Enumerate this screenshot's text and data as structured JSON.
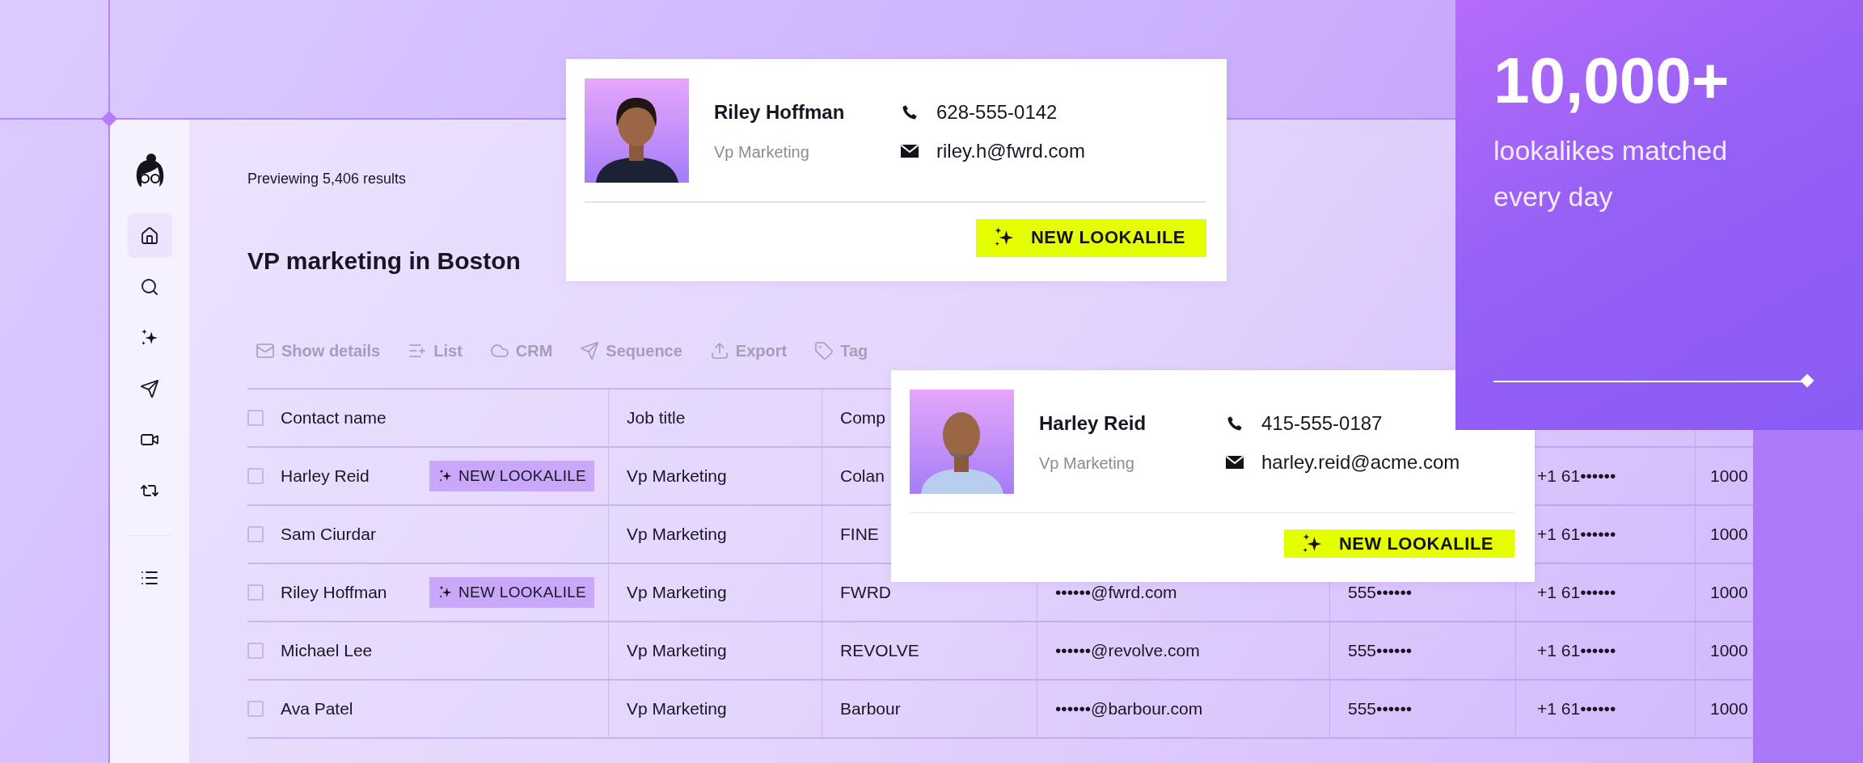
{
  "sidebar": {
    "items": [
      {
        "selected": true
      },
      {
        "selected": false
      },
      {
        "selected": false
      },
      {
        "selected": false
      },
      {
        "selected": false
      },
      {
        "selected": false
      }
    ],
    "bottom_items": [
      {
        "selected": false
      }
    ]
  },
  "header": {
    "result_count": "Previewing 5,406 results",
    "title": "VP marketing in Boston"
  },
  "toolbar": [
    {
      "label": "Show details",
      "disabled": true
    },
    {
      "label": "List",
      "disabled": true
    },
    {
      "label": "CRM",
      "disabled": true
    },
    {
      "label": "Sequence",
      "disabled": true
    },
    {
      "label": "Export",
      "disabled": true
    },
    {
      "label": "Tag",
      "disabled": true
    }
  ],
  "table": {
    "columns": [
      "Contact name",
      "Job title",
      "Comp"
    ],
    "header_checked": false,
    "rows": [
      {
        "checked": false,
        "name": "Harley Reid",
        "badge": "NEW LOOKALILE",
        "job_title": "Vp Marketing",
        "company": "Colan",
        "mobile": "+1 61••••••",
        "column_7": "1000"
      },
      {
        "checked": false,
        "name": "Sam Ciurdar",
        "job_title": "Vp Marketing",
        "company": "FINE",
        "mobile": "+1 61••••••",
        "column_7": "1000"
      },
      {
        "checked": false,
        "name": "Riley Hoffman",
        "badge": "NEW LOOKALILE",
        "job_title": "Vp Marketing",
        "company": "FWRD",
        "email": "••••••@fwrd.com",
        "phone": "555••••••",
        "mobile": "+1 61••••••",
        "column_7": "1000"
      },
      {
        "checked": false,
        "name": "Michael Lee",
        "job_title": "Vp Marketing",
        "company": "REVOLVE",
        "email": "••••••@revolve.com",
        "phone": "555••••••",
        "mobile": "+1 61••••••",
        "column_7": "1000"
      },
      {
        "checked": false,
        "name": "Ava Patel",
        "job_title": "Vp Marketing",
        "company": "Barbour",
        "email": "••••••@barbour.com",
        "phone": "555••••••",
        "mobile": "+1 61••••••",
        "column_7": "1000"
      }
    ]
  },
  "cards": [
    {
      "name": "Riley Hoffman",
      "title": "Vp Marketing",
      "phone": "628-555-0142",
      "email": "riley.h@fwrd.com",
      "badge": "NEW LOOKALILE"
    },
    {
      "name": "Harley Reid",
      "title": "Vp Marketing",
      "phone": "415-555-0187",
      "email": "harley.reid@acme.com",
      "badge": "NEW LOOKALILE"
    }
  ],
  "stat": {
    "value": "10,000+",
    "caption": "lookalikes matched every day"
  }
}
